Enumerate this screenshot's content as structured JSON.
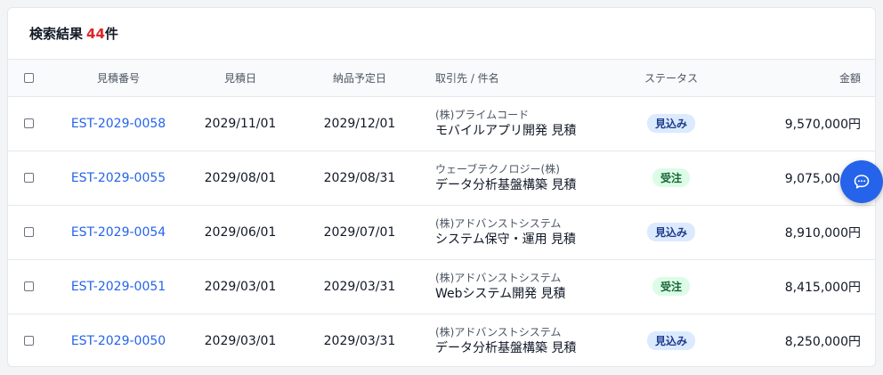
{
  "header": {
    "label": "検索結果",
    "count": "44",
    "unit": "件"
  },
  "columns": {
    "estimate_no": "見積番号",
    "estimate_date": "見積日",
    "delivery_date": "納品予定日",
    "client_subject": "取引先 / 件名",
    "status": "ステータス",
    "amount": "金額"
  },
  "rows": [
    {
      "estimate_no": "EST-2029-0058",
      "estimate_date": "2029/11/01",
      "delivery_date": "2029/12/01",
      "client": "(株)プライムコード",
      "subject": "モバイルアプリ開発 見積",
      "status": "見込み",
      "status_type": "pending",
      "amount": "9,570,000円"
    },
    {
      "estimate_no": "EST-2029-0055",
      "estimate_date": "2029/08/01",
      "delivery_date": "2029/08/31",
      "client": "ウェーブテクノロジー(株)",
      "subject": "データ分析基盤構築 見積",
      "status": "受注",
      "status_type": "won",
      "amount": "9,075,000円"
    },
    {
      "estimate_no": "EST-2029-0054",
      "estimate_date": "2029/06/01",
      "delivery_date": "2029/07/01",
      "client": "(株)アドバンストシステム",
      "subject": "システム保守・運用 見積",
      "status": "見込み",
      "status_type": "pending",
      "amount": "8,910,000円"
    },
    {
      "estimate_no": "EST-2029-0051",
      "estimate_date": "2029/03/01",
      "delivery_date": "2029/03/31",
      "client": "(株)アドバンストシステム",
      "subject": "Webシステム開発 見積",
      "status": "受注",
      "status_type": "won",
      "amount": "8,415,000円"
    },
    {
      "estimate_no": "EST-2029-0050",
      "estimate_date": "2029/03/01",
      "delivery_date": "2029/03/31",
      "client": "(株)アドバンストシステム",
      "subject": "データ分析基盤構築 見積",
      "status": "見込み",
      "status_type": "pending",
      "amount": "8,250,000円"
    }
  ],
  "colors": {
    "link": "#2563eb",
    "count": "#dc2626",
    "badge_pending_bg": "#dbeafe",
    "badge_won_bg": "#dcfce7",
    "fab": "#2563eb"
  },
  "fab": {
    "icon": "chat-bubble-icon"
  }
}
